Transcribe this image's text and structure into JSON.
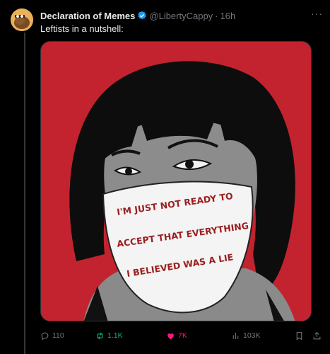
{
  "author": {
    "display_name": "Declaration of Memes",
    "handle": "@LibertyCappy",
    "separator": "·",
    "time": "16h"
  },
  "tweet": {
    "text": "Leftists in a nutshell:"
  },
  "media": {
    "mask_text_line1": "I'M JUST NOT READY TO",
    "mask_text_line2": "ACCEPT THAT EVERYTHING",
    "mask_text_line3": "I BELIEVED WAS A LIE",
    "background_color": "#c3232e"
  },
  "actions": {
    "replies": "110",
    "retweets": "1.1K",
    "likes": "7K",
    "views": "103K"
  },
  "colors": {
    "verified": "#1d9bf0",
    "retweeted": "#00ba7c",
    "liked": "#f91880",
    "muted": "#71767b"
  }
}
